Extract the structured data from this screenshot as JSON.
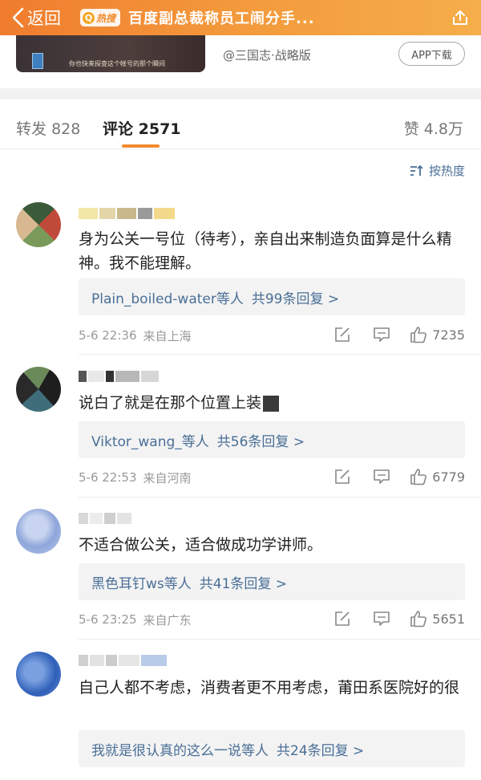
{
  "header": {
    "back_label": "返回",
    "hot_badge": "热搜",
    "title": "百度副总裁称员工闹分手..."
  },
  "promo": {
    "caption": "你也快来探查这个帐号的那个瞬间",
    "source": "@三国志·战略版",
    "app_button": "APP下载"
  },
  "tabs": {
    "repost_label": "转发",
    "repost_count": "828",
    "comment_label": "评论",
    "comment_count": "2571",
    "like_label": "赞",
    "like_count": "4.8万"
  },
  "sort_label": "按热度",
  "comments": [
    {
      "text": "身为公关一号位（待考），亲自出来制造负面算是什么精神。我不能理解。",
      "replies_user": "Plain_boiled-water等人",
      "replies_count": "共99条回复 >",
      "time": "5-6 22:36",
      "location": "来自上海",
      "likes": "7235"
    },
    {
      "text": "说白了就是在那个位置上装",
      "replies_user": "Viktor_wang_等人",
      "replies_count": "共56条回复 >",
      "time": "5-6 22:53",
      "location": "来自河南",
      "likes": "6779"
    },
    {
      "text": "不适合做公关，适合做成功学讲师。",
      "replies_user": "黑色耳钉ws等人",
      "replies_count": "共41条回复 >",
      "time": "5-6 23:25",
      "location": "来自广东",
      "likes": "5651"
    },
    {
      "text": "自己人都不考虑，消费者更不用考虑，莆田系医院好的很",
      "replies_user": "我就是很认真的这么一说等人",
      "replies_count": "共24条回复 >",
      "time": "",
      "location": "",
      "likes": ""
    }
  ],
  "colors": {
    "header_gradient_start": "#f07c2e",
    "header_gradient_end": "#f5ae4a",
    "link_blue": "#4a6f97",
    "tab_underline": "#f28a2c"
  },
  "icons": [
    "back-chevron-icon",
    "share-icon",
    "sort-icon",
    "edit-icon",
    "reply-icon",
    "like-icon"
  ]
}
